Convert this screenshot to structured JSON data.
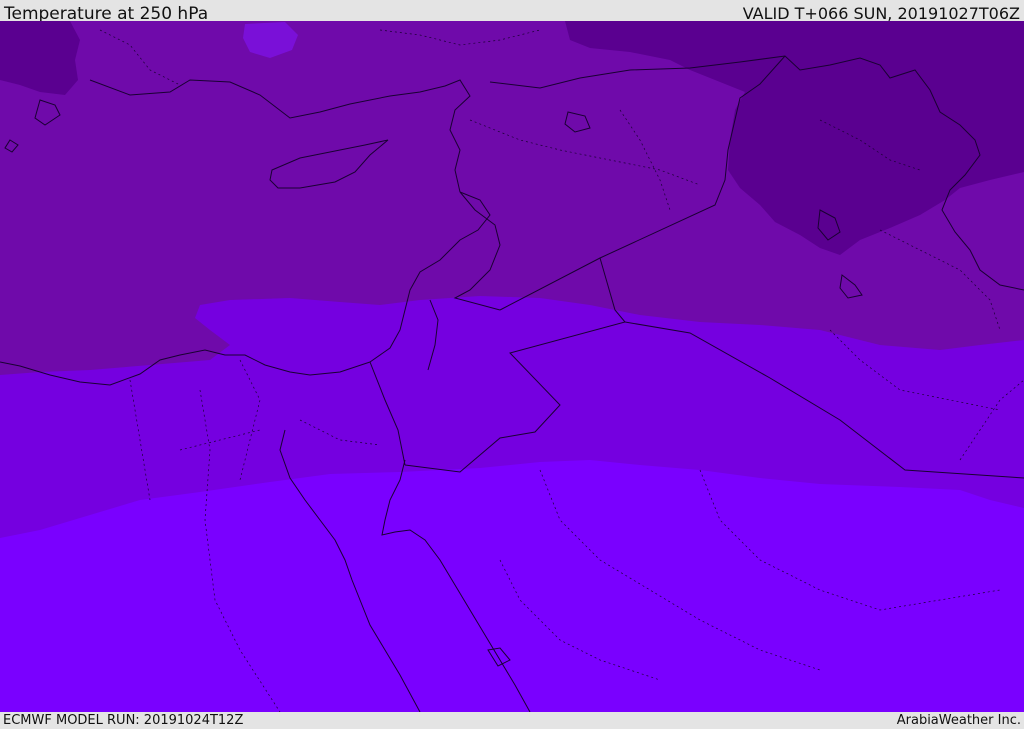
{
  "header": {
    "title": "Temperature at 250 hPa",
    "valid_time": "VALID T+066 SUN, 20191027T06Z"
  },
  "footer": {
    "model_run": "ECMWF MODEL RUN: 20191024T12Z",
    "credit": "ArabiaWeather Inc."
  },
  "colors": {
    "coldest_band": "#5a0090",
    "cold_band": "#6f0aaa",
    "mid_band": "#7500e0",
    "warm_band": "#7a00ff",
    "coastline": "#1a0033",
    "frame": "#e4e4e4"
  }
}
